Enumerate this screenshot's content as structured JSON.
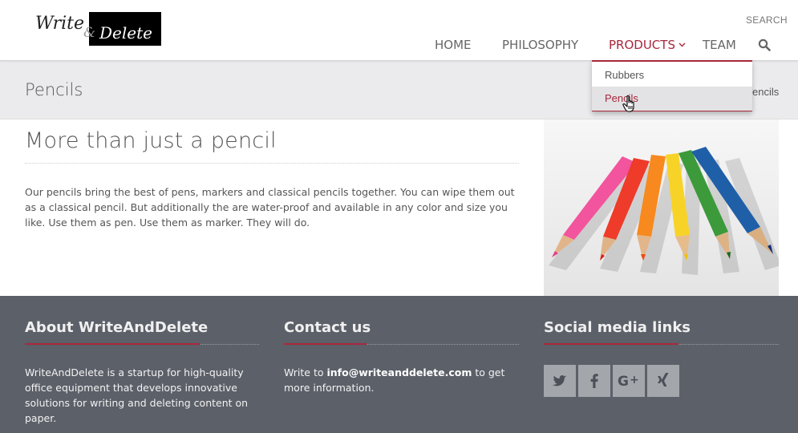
{
  "header": {
    "logo": {
      "word1": "Write",
      "amp": "&",
      "word2": "Delete"
    },
    "search_label": "SEARCH",
    "nav": [
      {
        "label": "HOME",
        "active": false
      },
      {
        "label": "PHILOSOPHY",
        "active": false
      },
      {
        "label": "PRODUCTS",
        "active": true
      },
      {
        "label": "TEAM",
        "active": false
      }
    ]
  },
  "dropdown": {
    "items": [
      {
        "label": "Rubbers",
        "selected": false
      },
      {
        "label": "Pencils",
        "selected": true
      }
    ]
  },
  "page": {
    "title": "Pencils",
    "breadcrumb_visible": "encils"
  },
  "content": {
    "heading": "More than just a pencil",
    "paragraph": "Our pencils bring the best of pens, markers and classical pencils together. You can wipe them out as a classical pencil. But additionally the are water-proof and available in any color and size you like. Use them as pen. Use them as marker. They will do.",
    "image": {
      "icon": "colored-pencils-photo"
    }
  },
  "footer": {
    "about": {
      "title": "About WriteAndDelete",
      "text": "WriteAndDelete is a startup for high-quality office equipment that develops innovative solutions for writing and deleting content on paper."
    },
    "contact": {
      "title": "Contact us",
      "prefix": "Write to ",
      "email": "info@writeanddelete.com",
      "suffix": " to get more information."
    },
    "social": {
      "title": "Social media links",
      "links": [
        {
          "icon": "twitter-icon"
        },
        {
          "icon": "facebook-icon"
        },
        {
          "icon": "google-plus-icon"
        },
        {
          "icon": "xing-icon"
        }
      ]
    }
  },
  "colors": {
    "accent": "#a8283c",
    "footer_bg": "#5c6069",
    "titlebar_bg": "#ebebed",
    "social_tile": "#a3a6ab"
  }
}
